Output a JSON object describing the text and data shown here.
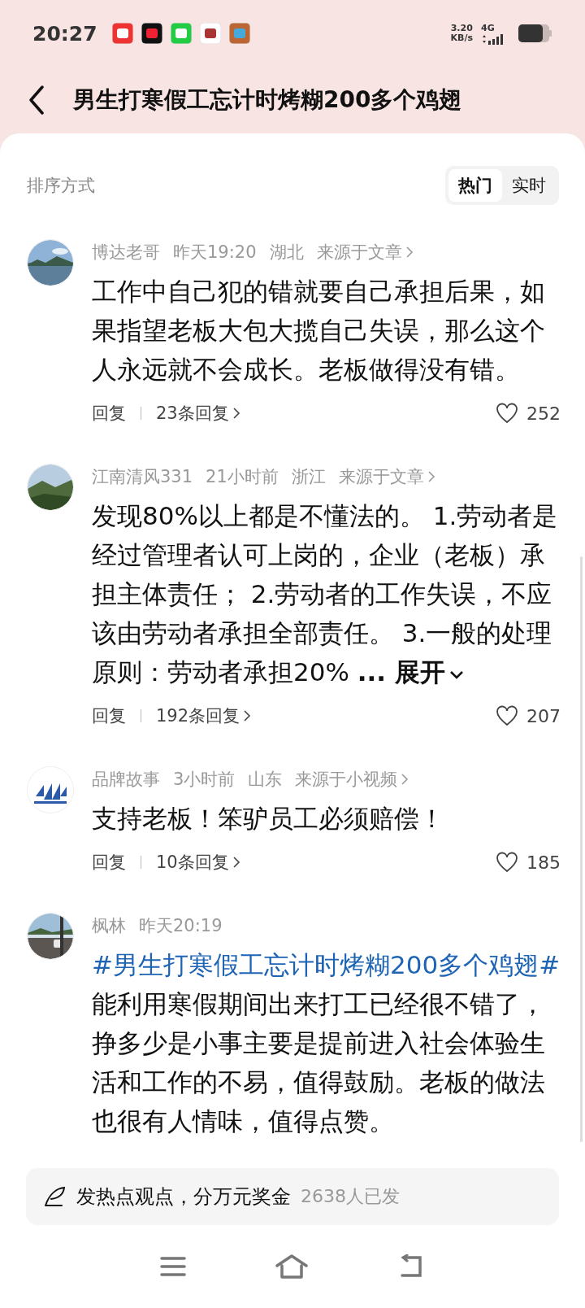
{
  "status_bar": {
    "time": "20:27",
    "speed": "3.20",
    "speed_unit": "KB/s",
    "network": "4G"
  },
  "header": {
    "title": "男生打寒假工忘计时烤糊200多个鸡翅"
  },
  "sort": {
    "label": "排序方式",
    "tabs": [
      {
        "label": "热门",
        "selected": true
      },
      {
        "label": "实时",
        "selected": false
      }
    ]
  },
  "comments": [
    {
      "name": "博达老哥",
      "time": "昨天19:20",
      "region": "湖北",
      "source": "来源于文章",
      "parts": [
        {
          "kind": "plain",
          "text": "工作中自己犯的错就要自己承担后果，如果指望老板大包大揽自己失误，那么这个人永远就不会成长。老板做得没有错。"
        }
      ],
      "reply": "回复",
      "replies": "23条回复",
      "likes": "252"
    },
    {
      "name": "江南清风331",
      "time": "21小时前",
      "region": "浙江",
      "source": "来源于文章",
      "parts": [
        {
          "kind": "plain",
          "text": "发现80%以上都是不懂法的。 1.劳动者是经过管理者认可上岗的，企业（老板）承担主体责任； 2.劳动者的工作失误，不应该由劳动者承担全部责任。 3.一般的处理原则：劳动者承担20%"
        }
      ],
      "more": "...",
      "expand": "展开",
      "reply": "回复",
      "replies": "192条回复",
      "likes": "207"
    },
    {
      "name": "品牌故事",
      "time": "3小时前",
      "region": "山东",
      "source": "来源于小视频",
      "parts": [
        {
          "kind": "plain",
          "text": "支持老板！笨驴员工必须赔偿！"
        }
      ],
      "reply": "回复",
      "replies": "10条回复",
      "likes": "185"
    },
    {
      "name": "枫林",
      "time": "昨天20:19",
      "parts": [
        {
          "kind": "hashtag",
          "text": "#男生打寒假工忘计时烤糊200多个鸡翅"
        },
        {
          "kind": "hashtag",
          "text": "#"
        },
        {
          "kind": "plain",
          "text": "能利用寒假期间出来打工已经很不错了，挣多少是小事主要是提前进入社会体验生活和工作的不易，值得鼓励。老板的做法也很有人情味，值得点赞。"
        }
      ]
    }
  ],
  "post_bar": {
    "text": "发热点观点，分万元奖金",
    "count": "2638人已发"
  }
}
